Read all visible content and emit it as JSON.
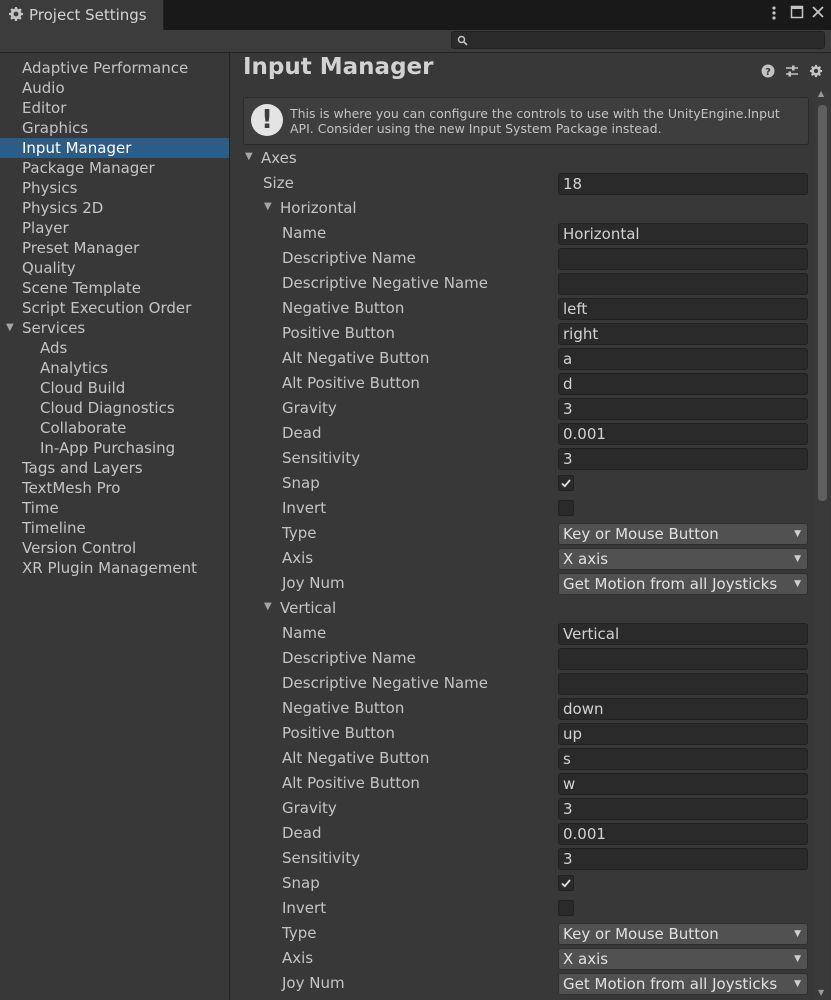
{
  "window": {
    "tab_title": "Project Settings",
    "menu_icon": "kebab-menu-icon",
    "maximize_icon": "maximize-icon",
    "close_icon": "close-icon"
  },
  "search": {
    "placeholder": "",
    "value": ""
  },
  "sidebar": {
    "selected": "Input Manager",
    "items": [
      {
        "label": "Adaptive Performance",
        "level": 0
      },
      {
        "label": "Audio",
        "level": 0
      },
      {
        "label": "Editor",
        "level": 0
      },
      {
        "label": "Graphics",
        "level": 0
      },
      {
        "label": "Input Manager",
        "level": 0
      },
      {
        "label": "Package Manager",
        "level": 0
      },
      {
        "label": "Physics",
        "level": 0
      },
      {
        "label": "Physics 2D",
        "level": 0
      },
      {
        "label": "Player",
        "level": 0
      },
      {
        "label": "Preset Manager",
        "level": 0
      },
      {
        "label": "Quality",
        "level": 0
      },
      {
        "label": "Scene Template",
        "level": 0
      },
      {
        "label": "Script Execution Order",
        "level": 0
      },
      {
        "label": "Services",
        "level": 0,
        "expanded": true
      },
      {
        "label": "Ads",
        "level": 1
      },
      {
        "label": "Analytics",
        "level": 1
      },
      {
        "label": "Cloud Build",
        "level": 1
      },
      {
        "label": "Cloud Diagnostics",
        "level": 1
      },
      {
        "label": "Collaborate",
        "level": 1
      },
      {
        "label": "In-App Purchasing",
        "level": 1
      },
      {
        "label": "Tags and Layers",
        "level": 0
      },
      {
        "label": "TextMesh Pro",
        "level": 0
      },
      {
        "label": "Time",
        "level": 0
      },
      {
        "label": "Timeline",
        "level": 0
      },
      {
        "label": "Version Control",
        "level": 0
      },
      {
        "label": "XR Plugin Management",
        "level": 0
      }
    ]
  },
  "main": {
    "title": "Input Manager",
    "header_icons": [
      "help-icon",
      "presets-icon",
      "settings-icon"
    ],
    "help_message": "This is where you can configure the controls to use with the UnityEngine.Input API. Consider using the new Input System Package instead.",
    "axes_label": "Axes",
    "size_label": "Size",
    "size_value": "18",
    "axes": [
      {
        "name": "Horizontal",
        "fields": {
          "name": "Horizontal",
          "descriptive_name": "",
          "descriptive_negative_name": "",
          "negative_button": "left",
          "positive_button": "right",
          "alt_negative_button": "a",
          "alt_positive_button": "d",
          "gravity": "3",
          "dead": "0.001",
          "sensitivity": "3",
          "snap": true,
          "invert": false,
          "type": "Key or Mouse Button",
          "axis": "X axis",
          "joy_num": "Get Motion from all Joysticks"
        }
      },
      {
        "name": "Vertical",
        "fields": {
          "name": "Vertical",
          "descriptive_name": "",
          "descriptive_negative_name": "",
          "negative_button": "down",
          "positive_button": "up",
          "alt_negative_button": "s",
          "alt_positive_button": "w",
          "gravity": "3",
          "dead": "0.001",
          "sensitivity": "3",
          "snap": true,
          "invert": false,
          "type": "Key or Mouse Button",
          "axis": "X axis",
          "joy_num": "Get Motion from all Joysticks"
        }
      }
    ],
    "field_labels": {
      "name": "Name",
      "descriptive_name": "Descriptive Name",
      "descriptive_negative_name": "Descriptive Negative Name",
      "negative_button": "Negative Button",
      "positive_button": "Positive Button",
      "alt_negative_button": "Alt Negative Button",
      "alt_positive_button": "Alt Positive Button",
      "gravity": "Gravity",
      "dead": "Dead",
      "sensitivity": "Sensitivity",
      "snap": "Snap",
      "invert": "Invert",
      "type": "Type",
      "axis": "Axis",
      "joy_num": "Joy Num"
    }
  },
  "colors": {
    "selection": "#2c5d87",
    "panel": "#383838",
    "field": "#2a2a2a",
    "dropdown": "#515151"
  }
}
